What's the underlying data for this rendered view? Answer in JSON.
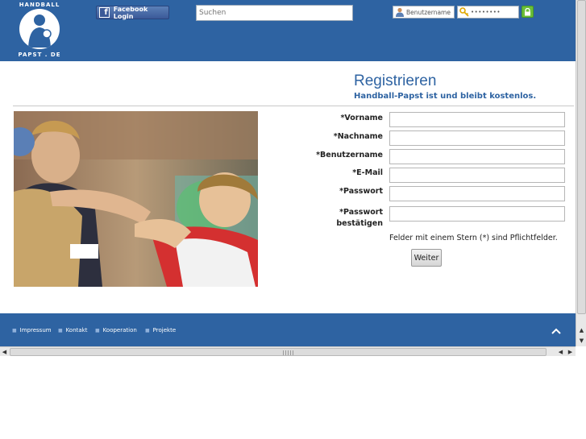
{
  "header": {
    "logo_top": "HANDBALL",
    "logo_bottom": "PAPST . DE",
    "facebook_label": "Facebook Login",
    "search_placeholder": "Suchen",
    "username_placeholder": "Benutzername",
    "password_placeholder": "••••••••"
  },
  "main": {
    "title": "Registrieren",
    "subtitle": "Handball-Papst ist und bleibt kostenlos.",
    "form": {
      "fields": [
        {
          "label": "*Vorname",
          "value": ""
        },
        {
          "label": "*Nachname",
          "value": ""
        },
        {
          "label": "*Benutzername",
          "value": ""
        },
        {
          "label": "*E-Mail",
          "value": ""
        },
        {
          "label": "*Passwort",
          "value": ""
        },
        {
          "label_line1": "*Passwort",
          "label_line2": "bestätigen",
          "value": ""
        }
      ],
      "required_note": "Felder mit einem Stern (*) sind Pflichtfelder.",
      "submit_label": "Weiter"
    }
  },
  "footer": {
    "links": [
      "Impressum",
      "Kontakt",
      "Kooperation",
      "Projekte"
    ]
  },
  "colors": {
    "brand_blue": "#2e63a2",
    "facebook_blue": "#3b5998",
    "lock_green": "#6bbf3a"
  },
  "icons": {
    "facebook": "facebook-icon",
    "user": "user-icon",
    "key": "key-icon",
    "lock": "lock-icon",
    "to_top": "chevron-up-icon"
  }
}
